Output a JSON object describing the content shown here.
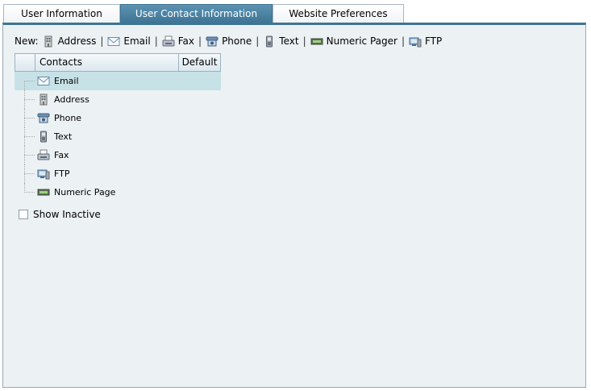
{
  "tabs": [
    {
      "label": "User Information",
      "active": false
    },
    {
      "label": "User Contact Information",
      "active": true
    },
    {
      "label": "Website Preferences",
      "active": false
    }
  ],
  "new_bar": {
    "label": "New:",
    "items": [
      {
        "label": "Address",
        "icon": "address-icon"
      },
      {
        "label": "Email",
        "icon": "email-icon"
      },
      {
        "label": "Fax",
        "icon": "fax-icon"
      },
      {
        "label": "Phone",
        "icon": "phone-icon"
      },
      {
        "label": "Text",
        "icon": "text-icon"
      },
      {
        "label": "Numeric Pager",
        "icon": "pager-icon"
      },
      {
        "label": "FTP",
        "icon": "ftp-icon"
      }
    ],
    "separator": "|"
  },
  "contacts_grid": {
    "columns": [
      "Contacts",
      "Default"
    ],
    "rows": [
      {
        "label": "Email",
        "icon": "email-icon",
        "selected": true
      },
      {
        "label": "Address",
        "icon": "address-icon",
        "selected": false
      },
      {
        "label": "Phone",
        "icon": "phone-icon",
        "selected": false
      },
      {
        "label": "Text",
        "icon": "text-icon",
        "selected": false
      },
      {
        "label": "Fax",
        "icon": "fax-icon",
        "selected": false
      },
      {
        "label": "FTP",
        "icon": "ftp-icon",
        "selected": false
      },
      {
        "label": "Numeric Page",
        "icon": "pager-icon",
        "selected": false
      }
    ]
  },
  "show_inactive": {
    "label": "Show Inactive",
    "checked": false
  },
  "colors": {
    "active_tab": "#4a82a3",
    "panel_bg": "#ecf1f4",
    "selected_row": "#c7e2e6"
  }
}
